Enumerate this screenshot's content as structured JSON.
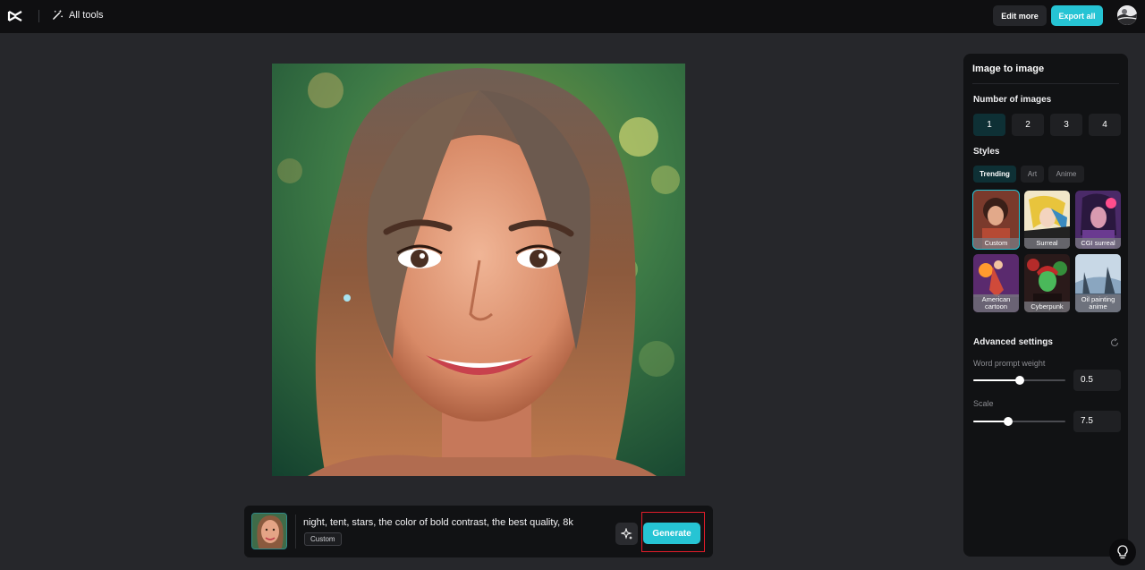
{
  "header": {
    "all_tools_label": "All tools",
    "edit_more_label": "Edit more",
    "export_all_label": "Export all"
  },
  "prompt": {
    "text": "night, tent, stars, the color of bold contrast, the best quality, 8k",
    "style_tag": "Custom",
    "generate_label": "Generate"
  },
  "panel": {
    "title": "Image to image",
    "number_label": "Number of images",
    "numbers": [
      "1",
      "2",
      "3",
      "4"
    ],
    "selected_number": "1",
    "styles_label": "Styles",
    "style_tabs": [
      "Trending",
      "Art",
      "Anime"
    ],
    "active_style_tab": "Trending",
    "style_cards": [
      "Custom",
      "Surreal",
      "CGI surreal",
      "American cartoon",
      "Cyberpunk",
      "Oil painting anime"
    ],
    "selected_style": "Custom",
    "advanced_label": "Advanced settings",
    "word_weight_label": "Word prompt weight",
    "word_weight_value": "0.5",
    "word_weight_fraction": 0.5,
    "scale_label": "Scale",
    "scale_value": "7.5",
    "scale_fraction": 0.375
  },
  "colors": {
    "accent": "#26c4d4",
    "highlight": "#e21d2a",
    "topbar": "#0f0f11",
    "canvas_bg": "#26272b"
  },
  "icons": [
    "capcut-logo-icon",
    "magic-wand-icon",
    "avatar",
    "sparkle-icon",
    "reset-icon",
    "lightbulb-icon"
  ]
}
